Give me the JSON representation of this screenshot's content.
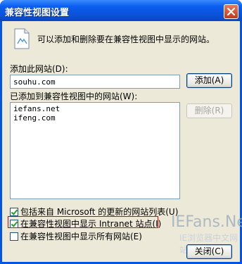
{
  "window": {
    "title": "兼容性视图设置",
    "close_symbol": "×"
  },
  "info": {
    "text": "可以添加和删除要在兼容性视图中显示的网站。"
  },
  "add_site": {
    "label": "添加此网站(D):",
    "value": "souhu.com",
    "add_button": "添加(A)"
  },
  "added_sites": {
    "label": "已添加到兼容性视图中的网站(W):",
    "items": [
      "iefans.net",
      "ifeng.com"
    ],
    "remove_button": "删除(R)"
  },
  "options": [
    {
      "label": "包括来自 Microsoft 的更新的网站列表(U)",
      "checked": true
    },
    {
      "label": "在兼容性视图中显示 Intranet 站点(I)",
      "checked": true
    },
    {
      "label": "在兼容性视图中显示所有网站(E)",
      "checked": false
    }
  ],
  "watermark": {
    "brand": "IEFans.Net",
    "sub": "IE浏览器中文网站"
  },
  "close_button": "关闭(C)",
  "colors": {
    "titlebar": "#0a53d8",
    "client": "#ece9d8",
    "highlight": "#e00000"
  }
}
